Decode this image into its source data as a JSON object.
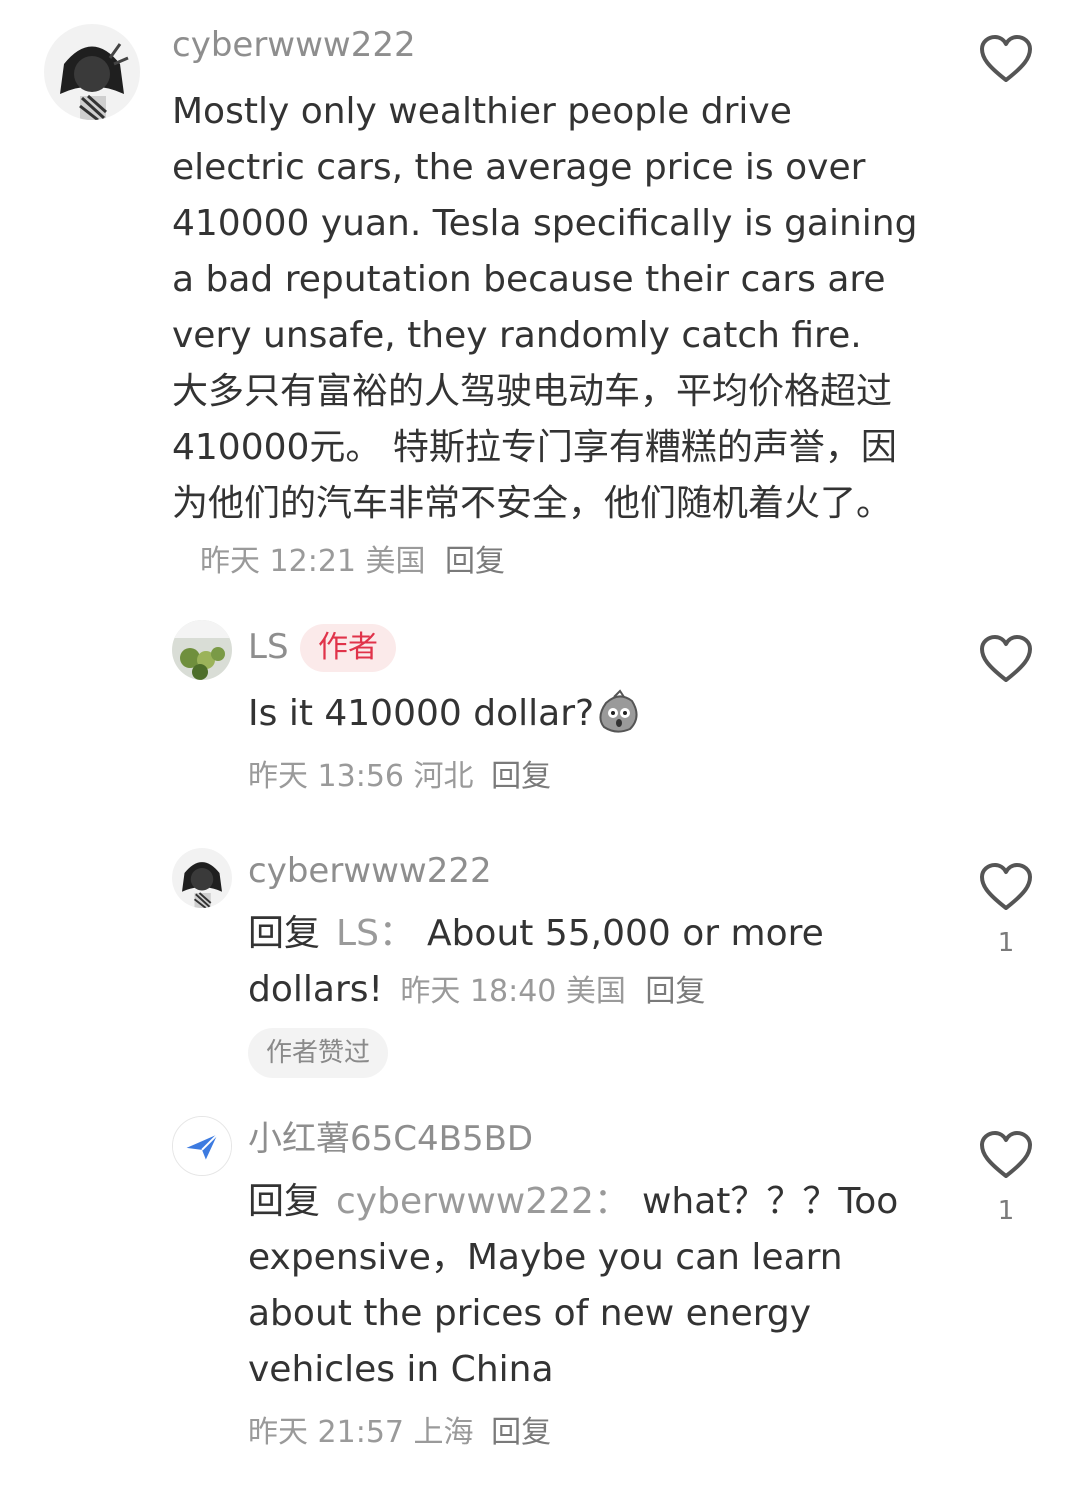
{
  "comments": [
    {
      "username": "cyberwww222",
      "text_en": "Mostly only wealthier people drive electric cars, the average price is over 410000 yuan. Tesla specifically is gaining a bad reputation because their cars are very unsafe, they randomly catch fire.",
      "text_zh": "大多只有富裕的人驾驶电动车，平均价格超过410000元。 特斯拉专门享有糟糕的声誉，因为他们的汽车非常不安全，他们随机着火了。",
      "meta": "昨天 12:21 美国",
      "reply_label": "回复"
    }
  ],
  "replies": [
    {
      "username": "LS",
      "author_tag": "作者",
      "text": "Is it 410000 dollar?",
      "emoji": "shocked-potato-emoji",
      "meta": "昨天 13:56 河北",
      "reply_label": "回复"
    },
    {
      "username": "cyberwww222",
      "reply_prefix": "回复",
      "reply_target": "LS：",
      "text": "About 55,000 or more dollars!",
      "meta": "昨天 18:40 美国",
      "reply_label": "回复",
      "badge": "作者赞过",
      "like_count": "1"
    },
    {
      "username": "小红薯65C4B5BD",
      "reply_prefix": "回复",
      "reply_target": "cyberwww222：",
      "text": "what？？？Too expensive，Maybe you can learn about the prices of new energy vehicles in China",
      "meta": "昨天 21:57 上海",
      "reply_label": "回复",
      "like_count": "1"
    }
  ],
  "icons": {
    "like": "heart-outline-icon",
    "avatar_default": "paper-plane-icon"
  },
  "colors": {
    "author_tag_text": "#e0334a",
    "author_tag_bg": "#fbeaea",
    "meta_text": "#9a9a9a",
    "body_text": "#333333"
  }
}
